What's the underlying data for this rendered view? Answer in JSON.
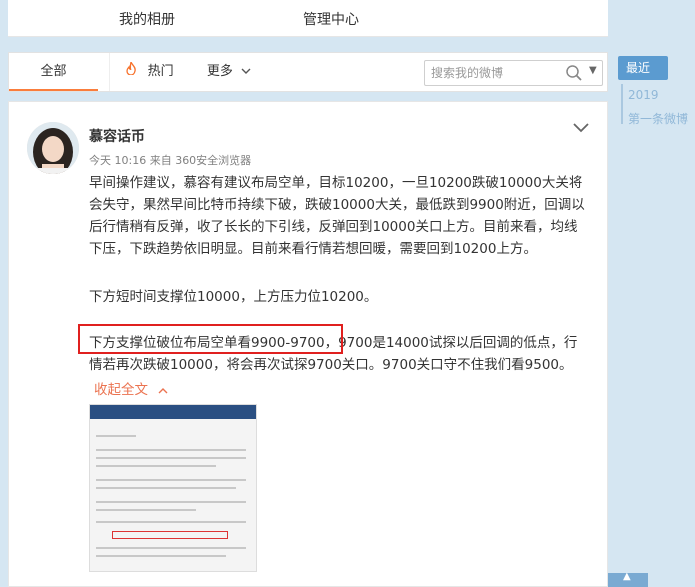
{
  "topnav": {
    "album": "我的相册",
    "admin": "管理中心"
  },
  "tabs": {
    "all": "全部",
    "hot": "热门",
    "more": "更多"
  },
  "search": {
    "placeholder": "搜索我的微博"
  },
  "post": {
    "username": "慕容话币",
    "meta": "今天 10:16 来自 360安全浏览器",
    "paragraph1": "早间操作建议，慕容有建议布局空单，目标10200，一旦10200跌破10000大关将会失守，果然早间比特币持续下破，跌破10000大关，最低跌到9900附近，回调以后行情稍有反弹，收了长长的下引线，反弹回到10000关口上方。目前来看，均线下压，下跌趋势依旧明显。目前来看行情若想回暖，需要回到10200上方。",
    "paragraph2": "下方短时间支撑位10000，上方压力位10200。",
    "paragraph3": "下方支撑位破位布局空单看9900-9700，9700是14000试探以后回调的低点，行情若再次跌破10000，将会再次试探9700关口。9700关口守不住我们看9500。",
    "collapse": "收起全文"
  },
  "sidebar": {
    "recent": "最近",
    "year": "2019",
    "first_post": "第一条微博"
  },
  "colors": {
    "accent_orange": "#fa7d3c",
    "highlight_red": "#e0201f",
    "link_orange": "#eb7350",
    "sidebar_blue": "#5b9bd0"
  },
  "icons": {
    "hot": "flame-icon",
    "search": "search-icon",
    "more_menu": "chevron-down-icon",
    "collapse": "chevron-up-icon"
  }
}
